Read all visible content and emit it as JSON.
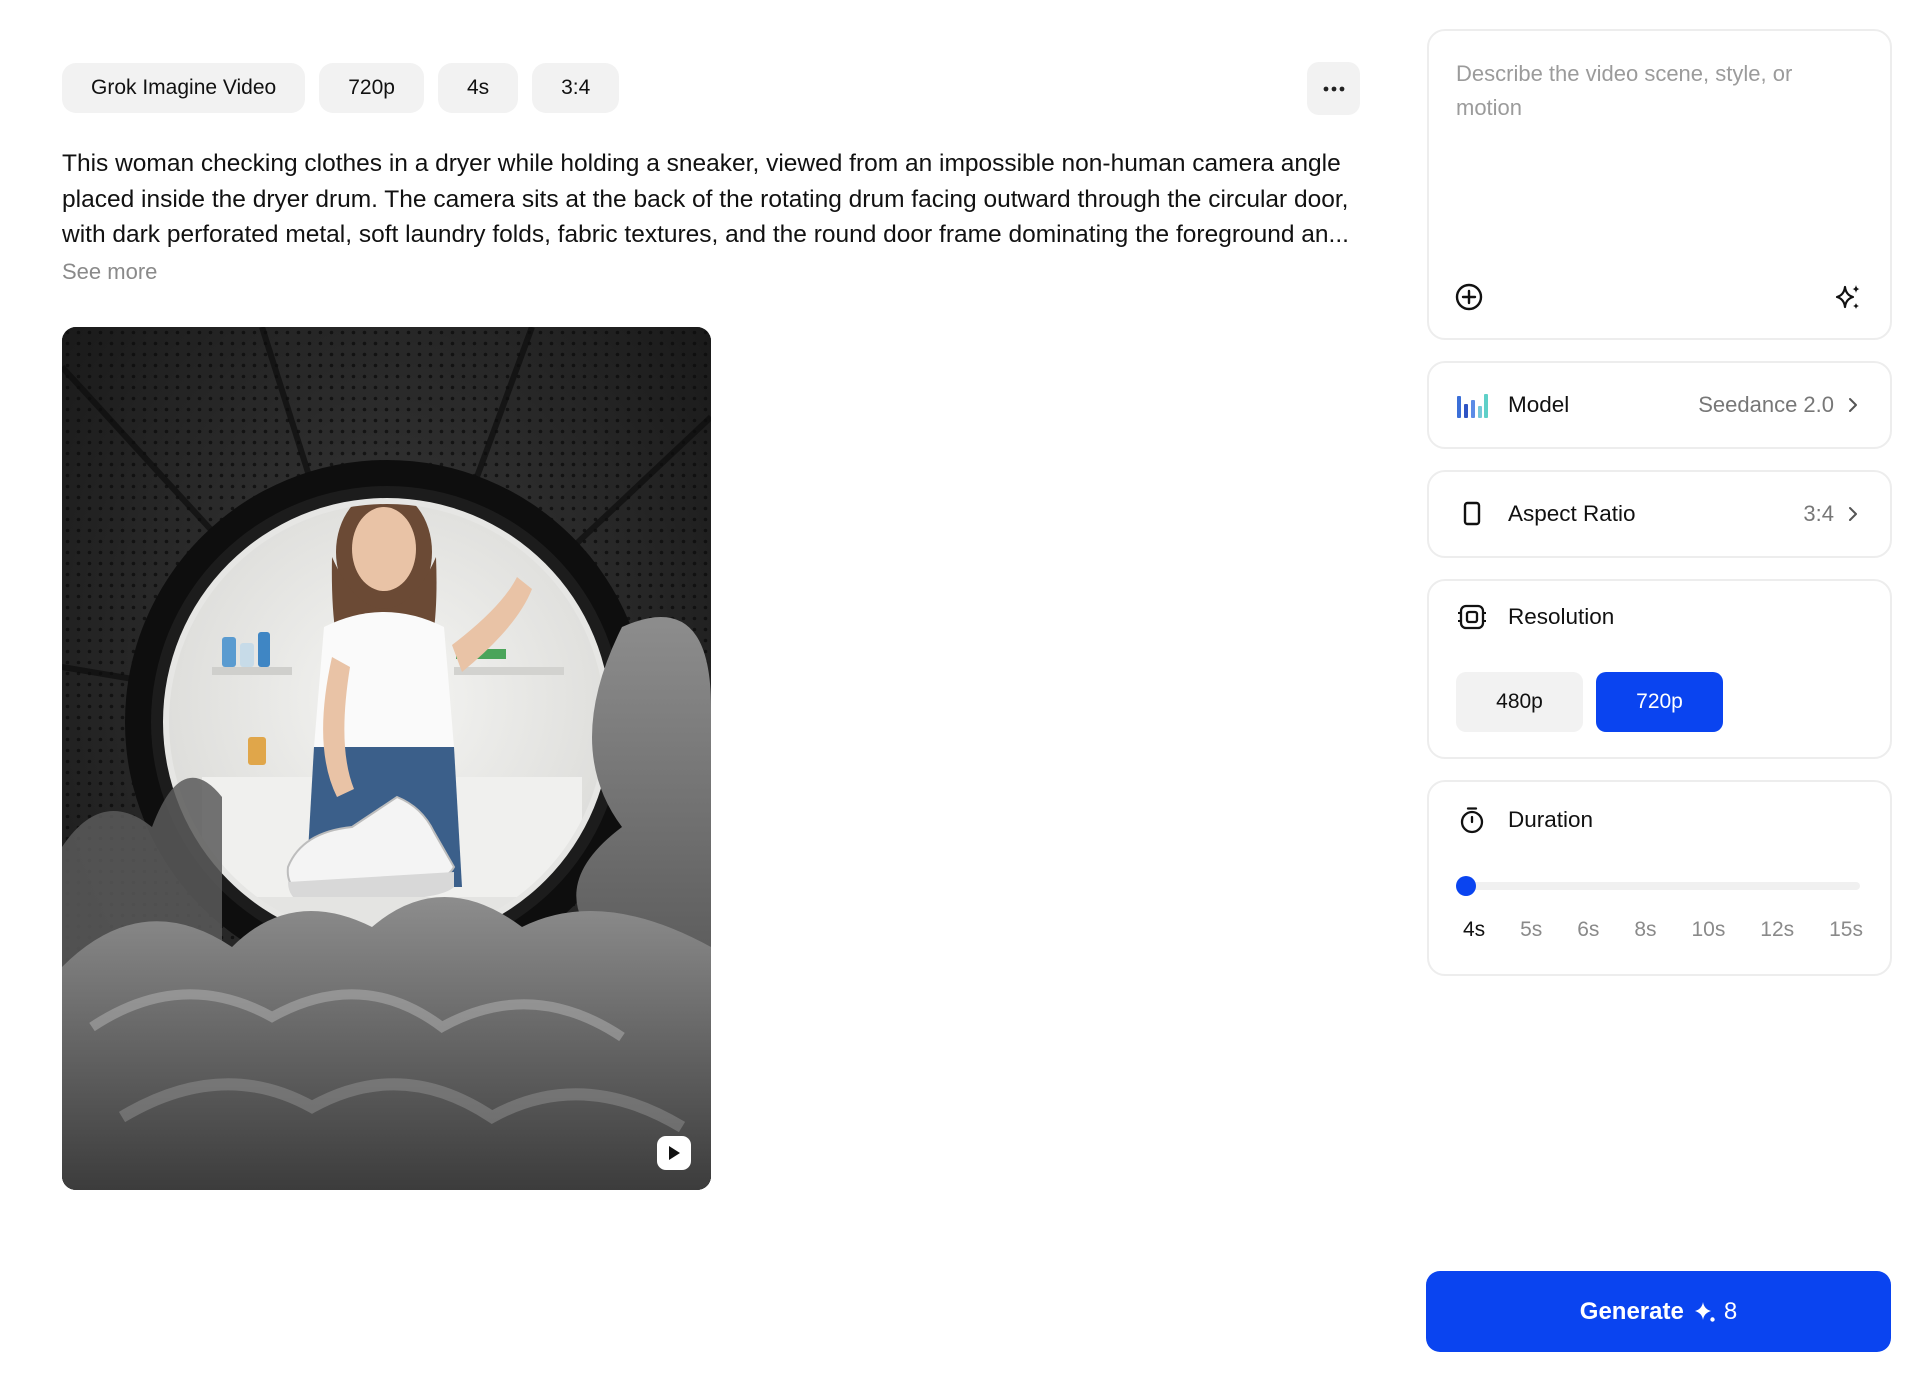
{
  "tags": [
    "Grok Imagine Video",
    "720p",
    "4s",
    "3:4"
  ],
  "more_menu_icon": "more-horizontal-icon",
  "prompt_text": "This woman checking clothes in a dryer while holding a sneaker, viewed from an impossible non-human camera angle placed inside the dryer drum. The camera sits at the back of the rotating drum facing outward through the circular door, with dark perforated metal, soft laundry folds, fabric textures, and the round door frame dominating the foreground an...",
  "see_more": "See more",
  "media": {
    "play_icon": "play-icon"
  },
  "prompt_box": {
    "placeholder": "Describe the video scene, style, or motion",
    "value": "",
    "add_icon": "plus-circle-icon",
    "enhance_icon": "sparkles-icon"
  },
  "settings": {
    "model": {
      "label": "Model",
      "value": "Seedance 2.0"
    },
    "aspect_ratio": {
      "label": "Aspect Ratio",
      "value": "3:4"
    },
    "resolution": {
      "label": "Resolution",
      "options": [
        "480p",
        "720p"
      ],
      "selected": "720p"
    },
    "duration": {
      "label": "Duration",
      "options": [
        "4s",
        "5s",
        "6s",
        "8s",
        "10s",
        "12s",
        "15s"
      ],
      "selected": "4s"
    }
  },
  "generate": {
    "label": "Generate",
    "cost": "8"
  },
  "colors": {
    "accent": "#0a44f0",
    "chip_bg": "#f2f2f2",
    "card_border": "#ededed",
    "muted_text": "#8a8a8a"
  }
}
